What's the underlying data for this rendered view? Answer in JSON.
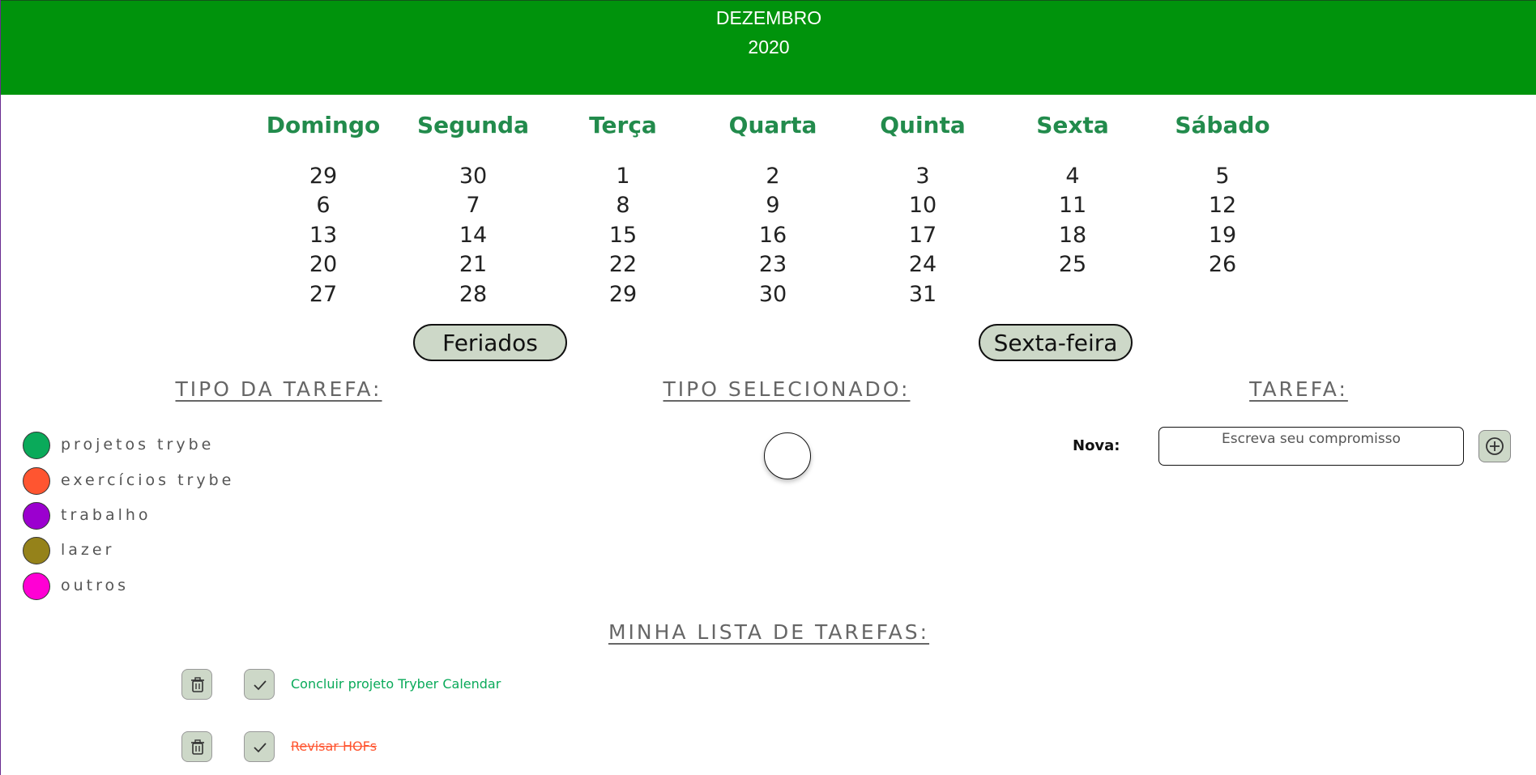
{
  "header": {
    "month": "DEZEMBRO",
    "year": "2020"
  },
  "weekdays": [
    "Domingo",
    "Segunda",
    "Terça",
    "Quarta",
    "Quinta",
    "Sexta",
    "Sábado"
  ],
  "weeks": [
    [
      "29",
      "30",
      "1",
      "2",
      "3",
      "4",
      "5"
    ],
    [
      "6",
      "7",
      "8",
      "9",
      "10",
      "11",
      "12"
    ],
    [
      "13",
      "14",
      "15",
      "16",
      "17",
      "18",
      "19"
    ],
    [
      "20",
      "21",
      "22",
      "23",
      "24",
      "25",
      "26"
    ],
    [
      "27",
      "28",
      "29",
      "30",
      "31",
      "",
      ""
    ]
  ],
  "buttons": {
    "holidays": "Feriados",
    "friday": "Sexta-feira"
  },
  "sections": {
    "task_type": "TIPO DA TAREFA:",
    "selected_type": "TIPO SELECIONADO:",
    "task": "TAREFA:"
  },
  "task_types": [
    {
      "label": "projetos trybe",
      "color": "#0aaa5a"
    },
    {
      "label": "exercícios trybe",
      "color": "#ff5530"
    },
    {
      "label": "trabalho",
      "color": "#9b00cf"
    },
    {
      "label": "lazer",
      "color": "#95821a"
    },
    {
      "label": "outros",
      "color": "#ff00d4"
    }
  ],
  "new_task": {
    "label": "Nova:",
    "placeholder": "Escreva seu compromisso",
    "add_icon": "plus-circle-icon"
  },
  "task_list": {
    "title": "MINHA LISTA DE TAREFAS:",
    "items": [
      {
        "text": "Concluir projeto Tryber Calendar",
        "color": "#0aaa5a",
        "done": false
      },
      {
        "text": "Revisar HOFs",
        "color": "#ff5530",
        "done": true
      }
    ]
  }
}
